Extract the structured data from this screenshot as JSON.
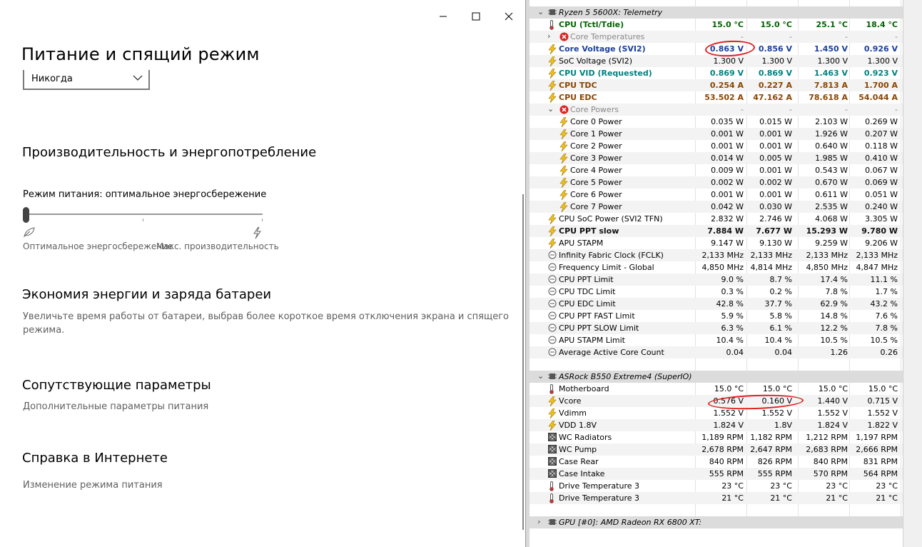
{
  "settings": {
    "title": "Питание и спящий режим",
    "sleep_dropdown_value": "Никогда",
    "perf_heading": "Производительность и энергопотребление",
    "power_mode_label": "Режим питания: оптимальное энергосбережение",
    "power_mode_level": 0,
    "slider_left_label": "Оптимальное энергосбережение",
    "slider_right_label": "Макс. производительность",
    "battery_heading": "Экономия энергии и заряда батареи",
    "battery_text_1": "Увеличьте время работы от батареи, выбрав более короткое время отключения экрана и спящего",
    "battery_text_2": "режима.",
    "related_heading": "Сопутствующие параметры",
    "related_link": "Дополнительные параметры питания",
    "help_heading": "Справка в Интернете",
    "help_link": "Изменение режима питания"
  },
  "hwinfo": {
    "rows": [
      {
        "kind": "group",
        "label": "Ryzen 5 5600X: Telemetry",
        "icon": "chip-icon"
      },
      {
        "kind": "sensor",
        "icon": "thermometer-icon",
        "label": "CPU (Tctl/Tdie)",
        "style": "green",
        "v": [
          "15.0 °C",
          "15.0 °C",
          "25.1 °C",
          "18.4 °C"
        ]
      },
      {
        "kind": "sub",
        "icon": "error-icon",
        "label": "Core Temperatures",
        "style": "gray",
        "exp": "›",
        "v": [
          "-",
          "-",
          "-",
          "-"
        ]
      },
      {
        "kind": "sensor",
        "icon": "bolt-icon",
        "label": "Core Voltage (SVI2)",
        "style": "blue",
        "v": [
          "0.863 V",
          "0.856 V",
          "1.450 V",
          "0.926 V"
        ]
      },
      {
        "kind": "sensor",
        "icon": "bolt-icon",
        "label": "SoC Voltage (SVI2)",
        "style": "",
        "v": [
          "1.300 V",
          "1.300 V",
          "1.300 V",
          "1.300 V"
        ]
      },
      {
        "kind": "sensor",
        "icon": "bolt-icon",
        "label": "CPU VID (Requested)",
        "style": "teal",
        "v": [
          "0.869 V",
          "0.869 V",
          "1.463 V",
          "0.923 V"
        ]
      },
      {
        "kind": "sensor",
        "icon": "bolt-icon",
        "label": "CPU TDC",
        "style": "brown",
        "v": [
          "0.254 A",
          "0.227 A",
          "7.813 A",
          "1.700 A"
        ]
      },
      {
        "kind": "sensor",
        "icon": "bolt-icon",
        "label": "CPU EDC",
        "style": "brown",
        "v": [
          "53.502 A",
          "47.162 A",
          "78.618 A",
          "54.044 A"
        ]
      },
      {
        "kind": "sub",
        "icon": "error-icon",
        "label": "Core Powers",
        "style": "gray",
        "exp": "⌄",
        "v": [
          "-",
          "-",
          "-",
          "-"
        ]
      },
      {
        "kind": "child",
        "icon": "bolt-icon",
        "label": "Core 0 Power",
        "style": "",
        "v": [
          "0.035 W",
          "0.015 W",
          "2.103 W",
          "0.269 W"
        ]
      },
      {
        "kind": "child",
        "icon": "bolt-icon",
        "label": "Core 1 Power",
        "style": "",
        "v": [
          "0.001 W",
          "0.001 W",
          "1.926 W",
          "0.207 W"
        ]
      },
      {
        "kind": "child",
        "icon": "bolt-icon",
        "label": "Core 2 Power",
        "style": "",
        "v": [
          "0.001 W",
          "0.001 W",
          "0.640 W",
          "0.118 W"
        ]
      },
      {
        "kind": "child",
        "icon": "bolt-icon",
        "label": "Core 3 Power",
        "style": "",
        "v": [
          "0.014 W",
          "0.005 W",
          "1.985 W",
          "0.410 W"
        ]
      },
      {
        "kind": "child",
        "icon": "bolt-icon",
        "label": "Core 4 Power",
        "style": "",
        "v": [
          "0.009 W",
          "0.001 W",
          "0.543 W",
          "0.067 W"
        ]
      },
      {
        "kind": "child",
        "icon": "bolt-icon",
        "label": "Core 5 Power",
        "style": "",
        "v": [
          "0.002 W",
          "0.002 W",
          "0.670 W",
          "0.069 W"
        ]
      },
      {
        "kind": "child",
        "icon": "bolt-icon",
        "label": "Core 6 Power",
        "style": "",
        "v": [
          "0.001 W",
          "0.001 W",
          "0.611 W",
          "0.051 W"
        ]
      },
      {
        "kind": "child",
        "icon": "bolt-icon",
        "label": "Core 7 Power",
        "style": "",
        "v": [
          "0.042 W",
          "0.030 W",
          "2.535 W",
          "0.240 W"
        ]
      },
      {
        "kind": "sensor",
        "icon": "bolt-icon",
        "label": "CPU SoC Power (SVI2 TFN)",
        "style": "",
        "v": [
          "2.832 W",
          "2.746 W",
          "4.068 W",
          "3.305 W"
        ]
      },
      {
        "kind": "sensor",
        "icon": "bolt-icon",
        "label": "CPU PPT slow",
        "style": "dark",
        "v": [
          "7.884 W",
          "7.677 W",
          "15.293 W",
          "9.780 W"
        ]
      },
      {
        "kind": "sensor",
        "icon": "bolt-icon",
        "label": "APU STAPM",
        "style": "",
        "v": [
          "9.147 W",
          "9.130 W",
          "9.259 W",
          "9.206 W"
        ]
      },
      {
        "kind": "sensor",
        "icon": "clock-icon",
        "label": "Infinity Fabric Clock (FCLK)",
        "style": "",
        "v": [
          "2,133 MHz",
          "2,133 MHz",
          "2,133 MHz",
          "2,133 MHz"
        ]
      },
      {
        "kind": "sensor",
        "icon": "clock-icon",
        "label": "Frequency Limit - Global",
        "style": "",
        "v": [
          "4,850 MHz",
          "4,814 MHz",
          "4,850 MHz",
          "4,847 MHz"
        ]
      },
      {
        "kind": "sensor",
        "icon": "clock-icon",
        "label": "CPU PPT Limit",
        "style": "",
        "v": [
          "9.0 %",
          "8.7 %",
          "17.4 %",
          "11.1 %"
        ]
      },
      {
        "kind": "sensor",
        "icon": "clock-icon",
        "label": "CPU TDC Limit",
        "style": "",
        "v": [
          "0.3 %",
          "0.2 %",
          "7.8 %",
          "1.7 %"
        ]
      },
      {
        "kind": "sensor",
        "icon": "clock-icon",
        "label": "CPU EDC Limit",
        "style": "",
        "v": [
          "42.8 %",
          "37.7 %",
          "62.9 %",
          "43.2 %"
        ]
      },
      {
        "kind": "sensor",
        "icon": "clock-icon",
        "label": "CPU PPT FAST Limit",
        "style": "",
        "v": [
          "5.9 %",
          "5.8 %",
          "14.8 %",
          "7.6 %"
        ]
      },
      {
        "kind": "sensor",
        "icon": "clock-icon",
        "label": "CPU PPT SLOW Limit",
        "style": "",
        "v": [
          "6.3 %",
          "6.1 %",
          "12.2 %",
          "7.8 %"
        ]
      },
      {
        "kind": "sensor",
        "icon": "clock-icon",
        "label": "APU STAPM Limit",
        "style": "",
        "v": [
          "10.4 %",
          "10.4 %",
          "10.5 %",
          "10.5 %"
        ]
      },
      {
        "kind": "sensor",
        "icon": "clock-icon",
        "label": "Average Active Core Count",
        "style": "",
        "v": [
          "0.04",
          "0.04",
          "1.26",
          "0.26"
        ]
      },
      {
        "kind": "blank"
      },
      {
        "kind": "group",
        "label": "ASRock B550 Extreme4 (SuperIO)",
        "icon": "chip-icon",
        "exp": "⌄"
      },
      {
        "kind": "sensor",
        "icon": "thermometer-icon",
        "label": "Motherboard",
        "style": "",
        "v": [
          "15.0 °C",
          "15.0 °C",
          "15.0 °C",
          "15.0 °C"
        ]
      },
      {
        "kind": "sensor",
        "icon": "bolt-icon",
        "label": "Vcore",
        "style": "",
        "v": [
          "0.576 V",
          "0.160 V",
          "1.440 V",
          "0.715 V"
        ]
      },
      {
        "kind": "sensor",
        "icon": "bolt-icon",
        "label": "Vdimm",
        "style": "",
        "v": [
          "1.552 V",
          "1.552 V",
          "1.552 V",
          "1.552 V"
        ]
      },
      {
        "kind": "sensor",
        "icon": "bolt-icon",
        "label": "VDD 1.8V",
        "style": "",
        "v": [
          "1.824 V",
          "1.8V",
          "1.824 V",
          "1.822 V"
        ]
      },
      {
        "kind": "sensor",
        "icon": "fan-icon",
        "label": "WC Radiators",
        "style": "",
        "v": [
          "1,189 RPM",
          "1,182 RPM",
          "1,212 RPM",
          "1,197 RPM"
        ]
      },
      {
        "kind": "sensor",
        "icon": "fan-icon",
        "label": "WC Pump",
        "style": "",
        "v": [
          "2,678 RPM",
          "2,647 RPM",
          "2,683 RPM",
          "2,666 RPM"
        ]
      },
      {
        "kind": "sensor",
        "icon": "fan-icon",
        "label": "Case Rear",
        "style": "",
        "v": [
          "840 RPM",
          "826 RPM",
          "840 RPM",
          "831 RPM"
        ]
      },
      {
        "kind": "sensor",
        "icon": "fan-icon",
        "label": "Case Intake",
        "style": "",
        "v": [
          "555 RPM",
          "555 RPM",
          "570 RPM",
          "564 RPM"
        ]
      },
      {
        "kind": "sensor",
        "icon": "thermometer-icon",
        "label": "Drive Temperature 3",
        "style": "",
        "v": [
          "23 °C",
          "23 °C",
          "23 °C",
          "23 °C"
        ]
      },
      {
        "kind": "sensor",
        "icon": "thermometer-icon",
        "label": "Drive Temperature 3",
        "style": "",
        "v": [
          "21 °C",
          "21 °C",
          "21 °C",
          "21 °C"
        ]
      },
      {
        "kind": "blank"
      },
      {
        "kind": "group",
        "label": "GPU [#0]: AMD Radeon RX 6800 XT:",
        "icon": "chip-icon",
        "exp": "›"
      }
    ]
  }
}
